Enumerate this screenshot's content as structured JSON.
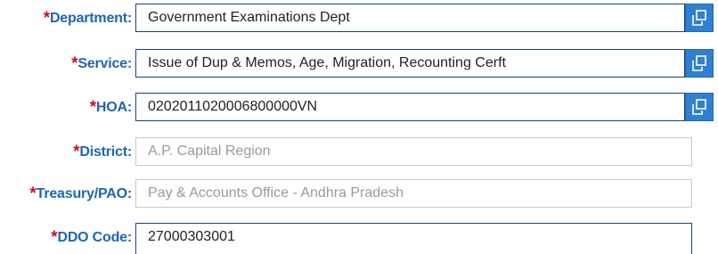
{
  "required_marker": "*",
  "fields": {
    "department": {
      "label": "Department:",
      "value": "Government Examinations  Dept",
      "lookup_icon": "popup-window-icon"
    },
    "service": {
      "label": "Service:",
      "value": "Issue of Dup & Memos, Age, Migration, Recounting Cerft",
      "lookup_icon": "popup-window-icon"
    },
    "hoa": {
      "label": "HOA:",
      "value": "0202011020006800000VN",
      "lookup_icon": "popup-window-icon"
    },
    "district": {
      "label": "District:",
      "value": "A.P. Capital Region"
    },
    "treasury": {
      "label": "Treasury/PAO:",
      "value": "Pay & Accounts Office -  Andhra Pradesh"
    },
    "ddo_code": {
      "label": "DDO Code:",
      "value": "27000303001"
    }
  },
  "colors": {
    "label": "#1e66b4",
    "required": "#c8102e",
    "button": "#2f80d1",
    "field_border": "#1f3f7a",
    "disabled_border": "#c9c9c9",
    "disabled_text": "#9a9a9a"
  }
}
